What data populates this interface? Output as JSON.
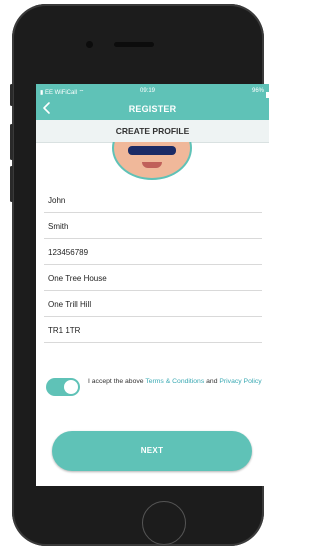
{
  "status_bar": {
    "carrier": "EE WiFiCall",
    "time": "09:19",
    "battery": "96%"
  },
  "nav": {
    "back_icon": "chevron-left-icon",
    "title": "REGISTER"
  },
  "section": {
    "title": "CREATE PROFILE"
  },
  "form": {
    "fields": [
      {
        "name": "first-name-field",
        "value": "John"
      },
      {
        "name": "last-name-field",
        "value": "Smith"
      },
      {
        "name": "phone-number-field",
        "value": "123456789"
      },
      {
        "name": "address-line-1-field",
        "value": "One Tree House"
      },
      {
        "name": "address-line-2-field",
        "value": "One Trill Hill"
      },
      {
        "name": "postcode-field",
        "value": "TR1 1TR"
      }
    ]
  },
  "terms": {
    "toggle_on": true,
    "prefix": "I accept the above ",
    "terms_link": "Terms & Conditions",
    "middle": " and ",
    "privacy_link": "Privacy Policy"
  },
  "next_button": {
    "label": "NEXT"
  },
  "colors": {
    "accent": "#5fc2b7",
    "link": "#3aa9b3"
  }
}
